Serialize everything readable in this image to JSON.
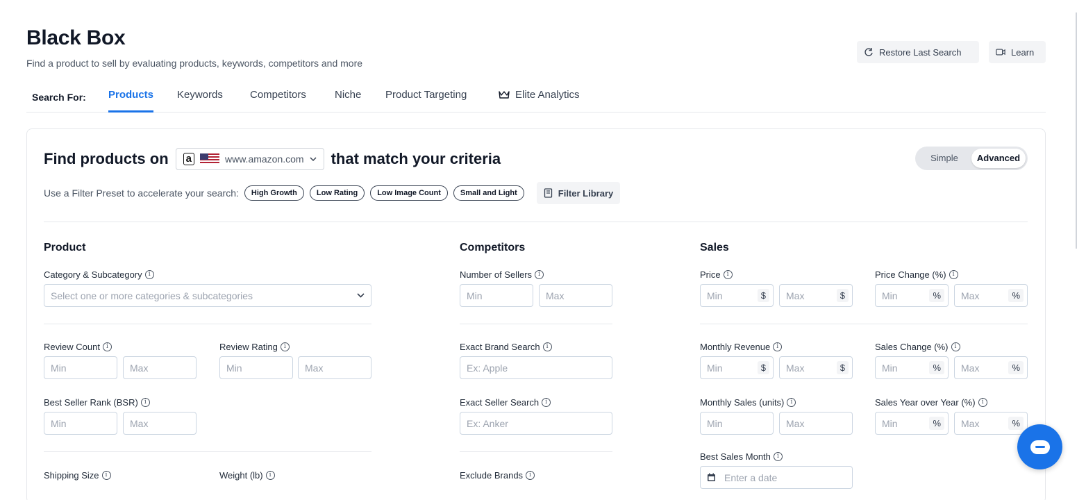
{
  "header": {
    "title": "Black Box",
    "subtitle": "Find a product to sell by evaluating products, keywords, competitors and more",
    "restore_label": "Restore Last Search",
    "learn_label": "Learn"
  },
  "tabs": {
    "search_for": "Search For:",
    "items": [
      "Products",
      "Keywords",
      "Competitors",
      "Niche",
      "Product Targeting",
      "Elite Analytics"
    ],
    "active": "Products"
  },
  "find": {
    "prefix": "Find products on",
    "marketplace": "www.amazon.com",
    "suffix": "that match your criteria",
    "mode_options": [
      "Simple",
      "Advanced"
    ],
    "mode_selected": "Advanced"
  },
  "presets": {
    "label": "Use a Filter Preset to accelerate your search:",
    "chips": [
      "High Growth",
      "Low Rating",
      "Low Image Count",
      "Small and Light"
    ],
    "library_label": "Filter Library"
  },
  "sections": {
    "product": "Product",
    "competitors": "Competitors",
    "sales": "Sales"
  },
  "fields": {
    "category": {
      "label": "Category & Subcategory",
      "placeholder": "Select one or more categories & subcategories"
    },
    "review_count": "Review Count",
    "review_rating": "Review Rating",
    "bsr": "Best Seller Rank (BSR)",
    "shipping_size": "Shipping Size",
    "weight": "Weight (lb)",
    "num_sellers": "Number of Sellers",
    "brand_search": {
      "label": "Exact Brand Search",
      "placeholder": "Ex: Apple"
    },
    "seller_search": {
      "label": "Exact Seller Search",
      "placeholder": "Ex: Anker"
    },
    "exclude_brands": "Exclude Brands",
    "price": "Price",
    "price_change": "Price Change (%)",
    "monthly_revenue": "Monthly Revenue",
    "sales_change": "Sales Change (%)",
    "monthly_sales": "Monthly Sales (units)",
    "sales_yoy": "Sales Year over Year (%)",
    "best_month": {
      "label": "Best Sales Month",
      "placeholder": "Enter a date"
    },
    "min": "Min",
    "max": "Max",
    "dollar": "$",
    "percent": "%",
    "info_glyph": "i"
  },
  "colors": {
    "accent": "#1a73e8",
    "text": "#111827",
    "border": "#cbd5e1"
  }
}
